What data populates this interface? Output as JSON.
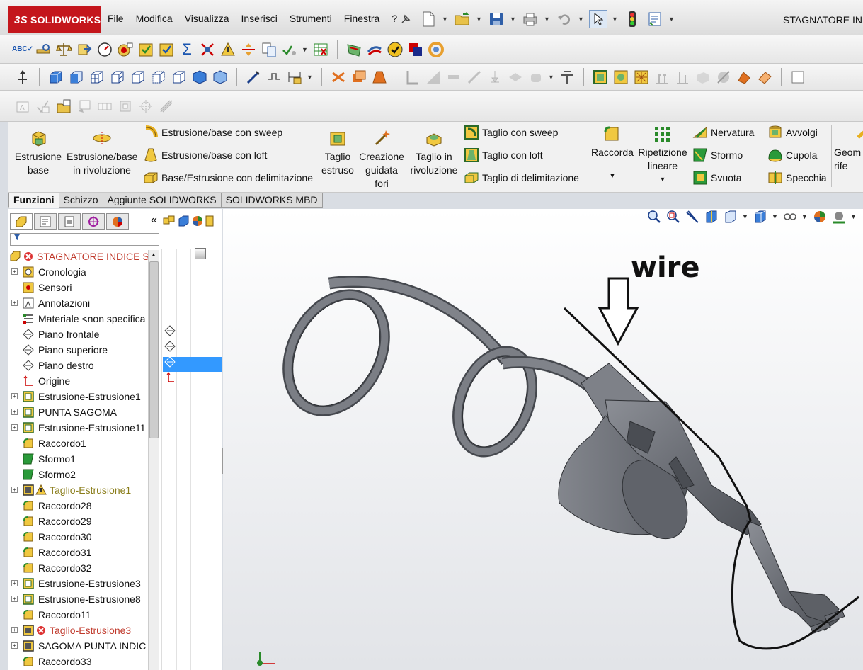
{
  "app": {
    "logo_text": "SOLIDWORKS",
    "logo_prefix": "3S",
    "document_title": "STAGNATORE INDI"
  },
  "menu": [
    "File",
    "Modifica",
    "Visualizza",
    "Inserisci",
    "Strumenti",
    "Finestra",
    "?"
  ],
  "command_manager": {
    "extrude_boss": "Estrusione base",
    "revolve_boss": "Estrusione/base in rivoluzione",
    "swept_boss": "Estrusione/base con sweep",
    "lofted_boss": "Estrusione/base con loft",
    "boundary_boss": "Base/Estrusione con delimitazione",
    "extruded_cut": "Taglio estruso",
    "hole_wizard": "Creazione guidata fori",
    "revolved_cut": "Taglio in rivoluzione",
    "swept_cut": "Taglio con sweep",
    "lofted_cut": "Taglio con loft",
    "boundary_cut": "Taglio di delimitazione",
    "fillet": "Raccorda",
    "linear_pattern": "Ripetizione lineare",
    "rib": "Nervatura",
    "draft": "Sformo",
    "shell": "Svuota",
    "wrap": "Avvolgi",
    "dome": "Cupola",
    "mirror": "Specchia",
    "ref_geometry": "Geom di rife"
  },
  "tabs": [
    "Funzioni",
    "Schizzo",
    "Aggiunte SOLIDWORKS",
    "SOLIDWORKS MBD"
  ],
  "tree": {
    "root": "STAGNATORE INDICE S",
    "items": [
      {
        "label": "Cronologia",
        "expand": true
      },
      {
        "label": "Sensori",
        "expand": false
      },
      {
        "label": "Annotazioni",
        "expand": true
      },
      {
        "label": "Materiale <non specifica",
        "expand": false
      },
      {
        "label": "Piano frontale",
        "expand": false
      },
      {
        "label": "Piano superiore",
        "expand": false
      },
      {
        "label": "Piano destro",
        "expand": false
      },
      {
        "label": "Origine",
        "expand": false
      },
      {
        "label": "Estrusione-Estrusione1",
        "expand": true
      },
      {
        "label": "PUNTA SAGOMA",
        "expand": true
      },
      {
        "label": "Estrusione-Estrusione11",
        "expand": true
      },
      {
        "label": "Raccordo1",
        "expand": false
      },
      {
        "label": "Sformo1",
        "expand": false
      },
      {
        "label": "Sformo2",
        "expand": false
      },
      {
        "label": "Taglio-Estrusione1",
        "expand": true,
        "state": "warn"
      },
      {
        "label": "Raccordo28",
        "expand": false
      },
      {
        "label": "Raccordo29",
        "expand": false
      },
      {
        "label": "Raccordo30",
        "expand": false
      },
      {
        "label": "Raccordo31",
        "expand": false
      },
      {
        "label": "Raccordo32",
        "expand": false
      },
      {
        "label": "Estrusione-Estrusione3",
        "expand": true
      },
      {
        "label": "Estrusione-Estrusione8",
        "expand": true
      },
      {
        "label": "Raccordo11",
        "expand": false
      },
      {
        "label": "Taglio-Estrusione3",
        "expand": true,
        "state": "err"
      },
      {
        "label": "SAGOMA PUNTA INDIC",
        "expand": true
      },
      {
        "label": "Raccordo33",
        "expand": false
      }
    ]
  },
  "viewport": {
    "annotation": "wire"
  },
  "colors": {
    "brand": "#c4161c",
    "selection": "#3399ff",
    "model": "#6e7076"
  }
}
